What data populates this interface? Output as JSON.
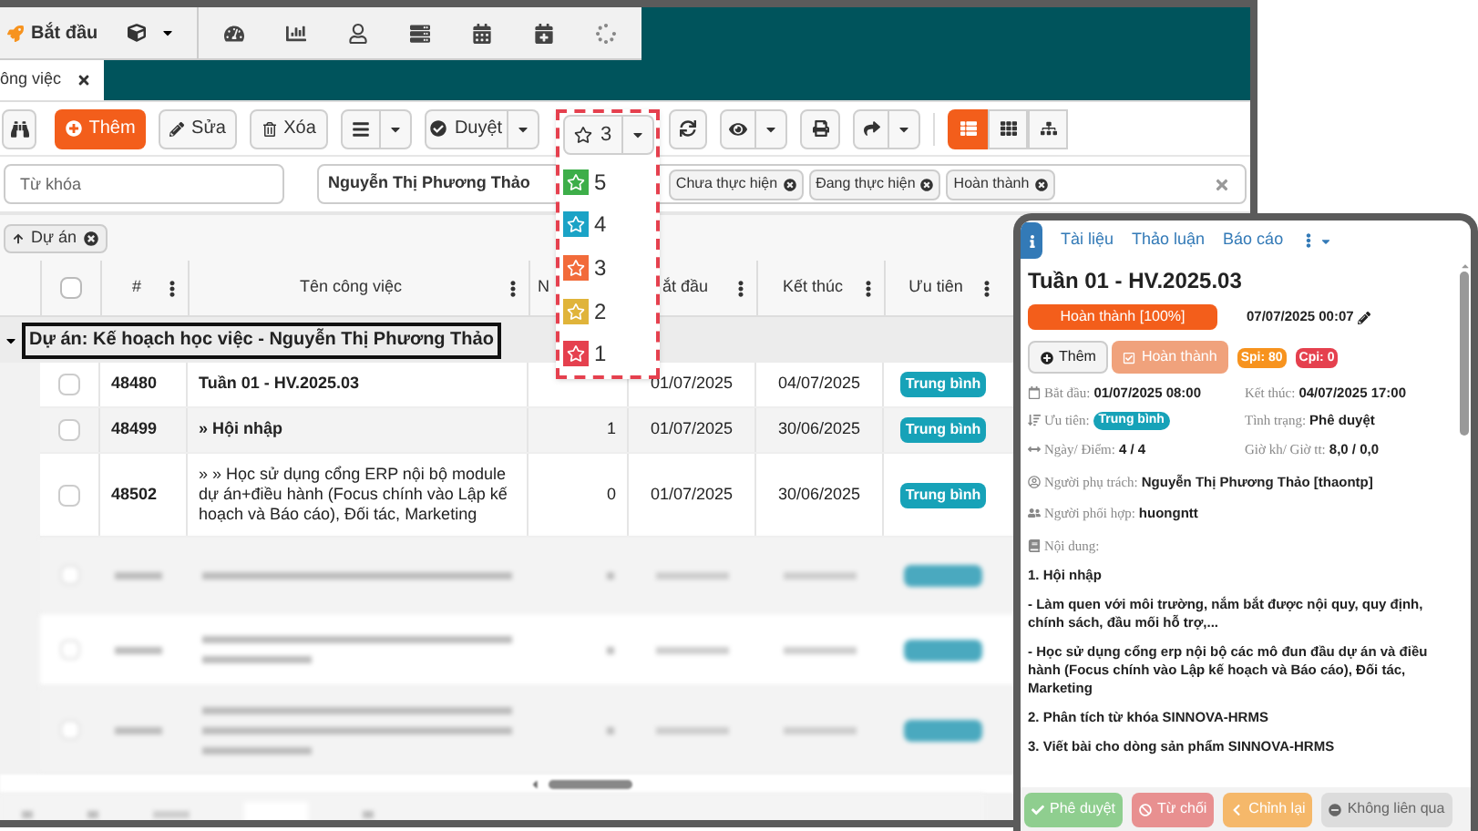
{
  "top_nav": {
    "start_label": "Bắt đầu"
  },
  "tab": {
    "label": "ông việc"
  },
  "toolbar": {
    "add": "Thêm",
    "edit": "Sửa",
    "delete": "Xóa",
    "approve": "Duyệt",
    "star_filter": "3"
  },
  "views": [
    {
      "kind": "list",
      "selected": true
    },
    {
      "kind": "grid",
      "selected": false
    },
    {
      "kind": "tree",
      "selected": false
    }
  ],
  "filters": {
    "keyword_placeholder": "Từ khóa",
    "assignee": "Nguyễn Thị Phương Thảo",
    "status_tags": [
      "Chưa thực hiện",
      "Đang thực hiện",
      "Hoàn thành"
    ]
  },
  "group_by_tag": "Dự án",
  "star_menu": [
    {
      "label": "5",
      "color": "#3dae49"
    },
    {
      "label": "4",
      "color": "#1ba3c6"
    },
    {
      "label": "3",
      "color": "#f26b3a"
    },
    {
      "label": "2",
      "color": "#e0b43a"
    },
    {
      "label": "1",
      "color": "#e5404e"
    }
  ],
  "table": {
    "header_checked": false,
    "columns": [
      "#",
      "Tên công việc",
      "N",
      "ắt đầu",
      "Kết thúc",
      "Ưu tiên"
    ],
    "group": {
      "label": "Dự án: Kế hoạch học việc - Nguyễn Thị Phương Thảo",
      "expanded": true
    },
    "rows": [
      {
        "kind": "task",
        "checked": false,
        "id": "48480",
        "name": "Tuần 01 - HV.2025.03",
        "start": "01/07/2025",
        "end": "04/07/2025",
        "priority": "Trung bình"
      },
      {
        "kind": "task",
        "checked": false,
        "id": "48499",
        "name": "» Hội nhập",
        "count": "1",
        "start": "01/07/2025",
        "end": "30/06/2025",
        "priority": "Trung bình"
      },
      {
        "kind": "task",
        "checked": false,
        "id": "48502",
        "name": "» » Học sử dụng cổng ERP nội bộ module dự án+điều hành (Focus chính vào Lập kế hoạch và Báo cáo), Đối tác, Marketing",
        "count": "0",
        "start": "01/07/2025",
        "end": "30/06/2025",
        "priority": "Trung bình"
      },
      {
        "kind": "blurred"
      },
      {
        "kind": "blurred"
      },
      {
        "kind": "blurred"
      }
    ]
  },
  "detail": {
    "tabs": [
      {
        "kind": "info",
        "selected": true
      },
      {
        "kind": "text",
        "label": "Tài liệu",
        "selected": false
      },
      {
        "kind": "text",
        "label": "Thảo luận",
        "selected": false
      },
      {
        "kind": "text",
        "label": "Báo cáo",
        "selected": false
      },
      {
        "kind": "more",
        "selected": false
      }
    ],
    "title": "Tuần 01 - HV.2025.03",
    "status": {
      "label": "Hoàn thành [100%]",
      "level": 1
    },
    "updated": "07/07/2025 00:07",
    "actions": [
      "Thêm",
      "Hoàn thành"
    ],
    "badges": [
      {
        "label": "Spi: 80",
        "color": "#f7931e"
      },
      {
        "label": "Cpi: 0",
        "color": "#e5404e"
      }
    ],
    "fields": [
      {
        "kind": "start",
        "label": "Bắt đầu:",
        "value": "01/07/2025 08:00"
      },
      {
        "kind": "plain",
        "label": "Kết thúc:",
        "value": "04/07/2025 17:00"
      },
      {
        "kind": "priority",
        "label": "Ưu tiên:",
        "value": "Trung bình"
      },
      {
        "kind": "plain",
        "label": "Tình trạng:",
        "value": "Phê duyệt"
      },
      {
        "kind": "days",
        "label": "Ngày/ Điểm:",
        "value": "4 / 4"
      },
      {
        "kind": "plain",
        "label": "Giờ kh/ Giờ tt:",
        "value": "8,0 / 0,0"
      }
    ],
    "people": [
      {
        "kind": "owner",
        "label": "Người phụ trách:",
        "value": "Nguyễn Thị Phương Thảo [thaontp]"
      },
      {
        "kind": "team",
        "label": "Người phối hợp:",
        "value": "huongntt"
      }
    ],
    "content_label": "Nội dung:",
    "content": [
      "1. Hội nhập",
      "- Làm quen với môi trường, nắm bắt được nội quy, quy định, chính sách, đầu mối hỗ trợ,...",
      "- Học sử dụng cổng erp nội bộ các mô đun đầu dự án và điều hành (Focus chính vào Lập kế hoạch và Báo cáo), Đối tác, Marketing",
      "2. Phân tích từ khóa SINNOVA-HRMS",
      "3. Viết bài cho dòng sản phẩm SINNOVA-HRMS"
    ],
    "footer": [
      {
        "kind": "approve",
        "label": "Phê duyệt"
      },
      {
        "kind": "reject",
        "label": "Từ chối"
      },
      {
        "kind": "revise",
        "label": "Chỉnh lại"
      },
      {
        "kind": "unrelated",
        "label": "Không liên qua"
      }
    ]
  }
}
